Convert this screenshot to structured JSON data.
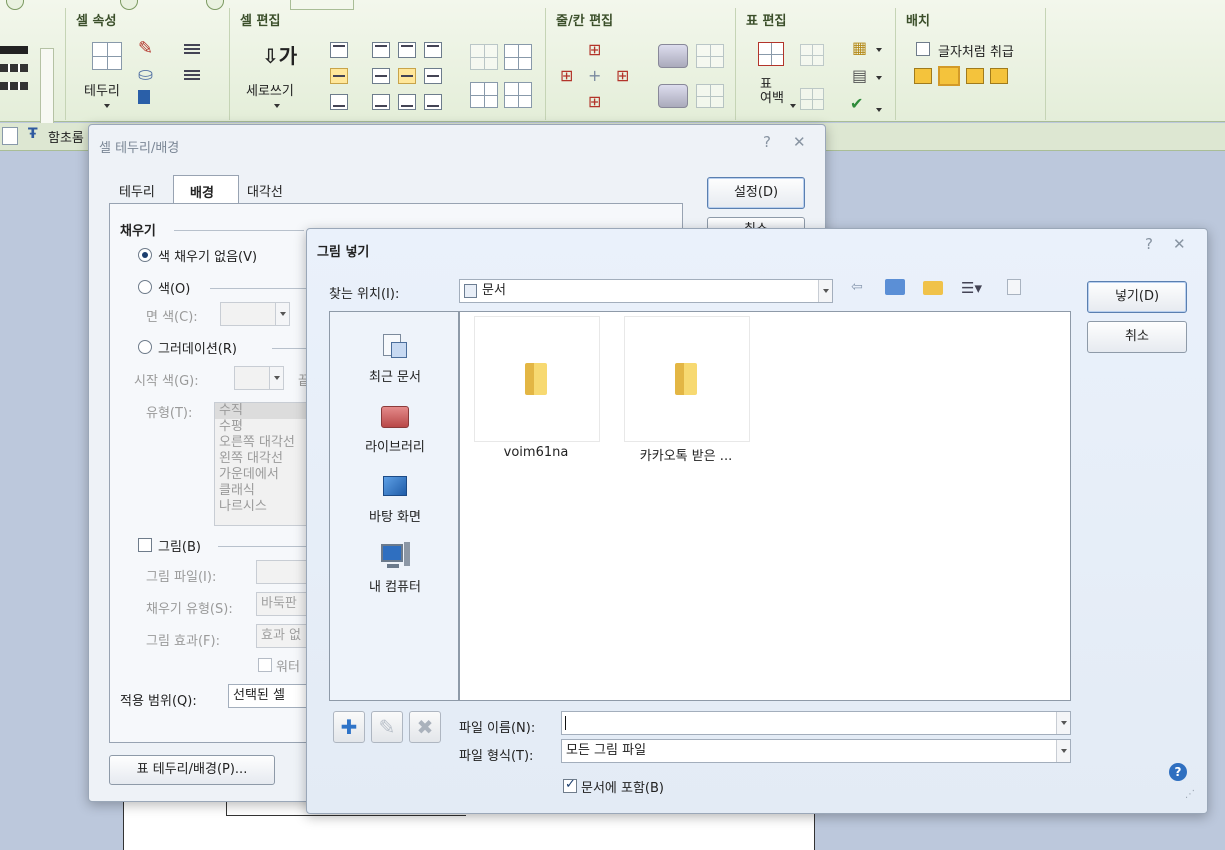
{
  "ribbon": {
    "groups": {
      "cell_props": "셀 속성",
      "cell_edit": "셀 편집",
      "row_col_edit": "줄/칸 편집",
      "table_edit": "표 편집",
      "arrange": "배치"
    },
    "border_label": "테두리",
    "vertical_text_label": "세로쓰기",
    "table_margin_label": "표\n여백",
    "treat_as_char_label": "글자처럼 취급",
    "quick_style_label": "함초롬"
  },
  "cell_dialog": {
    "title": "셀 테두리/배경",
    "tabs": [
      "테두리",
      "배경",
      "대각선"
    ],
    "active_tab": "배경",
    "ok_label": "설정(D)",
    "cancel_label_partial": "취소",
    "fill_group": "채우기",
    "radio_no_fill": "색 채우기 없음(V)",
    "radio_color": "색(O)",
    "face_color_label": "면 색(C):",
    "radio_gradient": "그러데이션(R)",
    "start_color_label": "시작 색(G):",
    "end_color_label_partial": "끝",
    "type_label": "유형(T):",
    "gradient_types": [
      "수직",
      "수평",
      "오른쪽 대각선",
      "왼쪽 대각선",
      "가운데에서",
      "클래식",
      "나르시스"
    ],
    "picture_check": "그림(B)",
    "picture_file_label": "그림 파일(I):",
    "fill_type_label": "채우기 유형(S):",
    "fill_type_value": "바둑판",
    "picture_effect_label": "그림 효과(F):",
    "picture_effect_value": "효과 없",
    "watermark_label": "워터",
    "apply_range_label": "적용 범위(Q):",
    "apply_range_value": "선택된 셀",
    "table_border_button": "표 테두리/배경(P)..."
  },
  "insert_dialog": {
    "title": "그림 넣기",
    "look_in_label": "찾는 위치(I):",
    "look_in_value": "문서",
    "places": [
      "최근 문서",
      "라이브러리",
      "바탕 화면",
      "내 컴퓨터"
    ],
    "files": [
      "voim61na",
      "카카오톡 받은 ..."
    ],
    "filename_label": "파일 이름(N):",
    "filename_value": "",
    "filetype_label": "파일 형식(T):",
    "filetype_value": "모든 그림 파일",
    "include_in_doc_label": "문서에 포함(B)",
    "include_in_doc_checked": true,
    "insert_button": "넣기(D)",
    "cancel_button": "취소"
  },
  "colors": {
    "ribbon_bg": "#e9f1df",
    "dialog_bg": "#eef2f7",
    "accent": "#1d3f6e"
  }
}
